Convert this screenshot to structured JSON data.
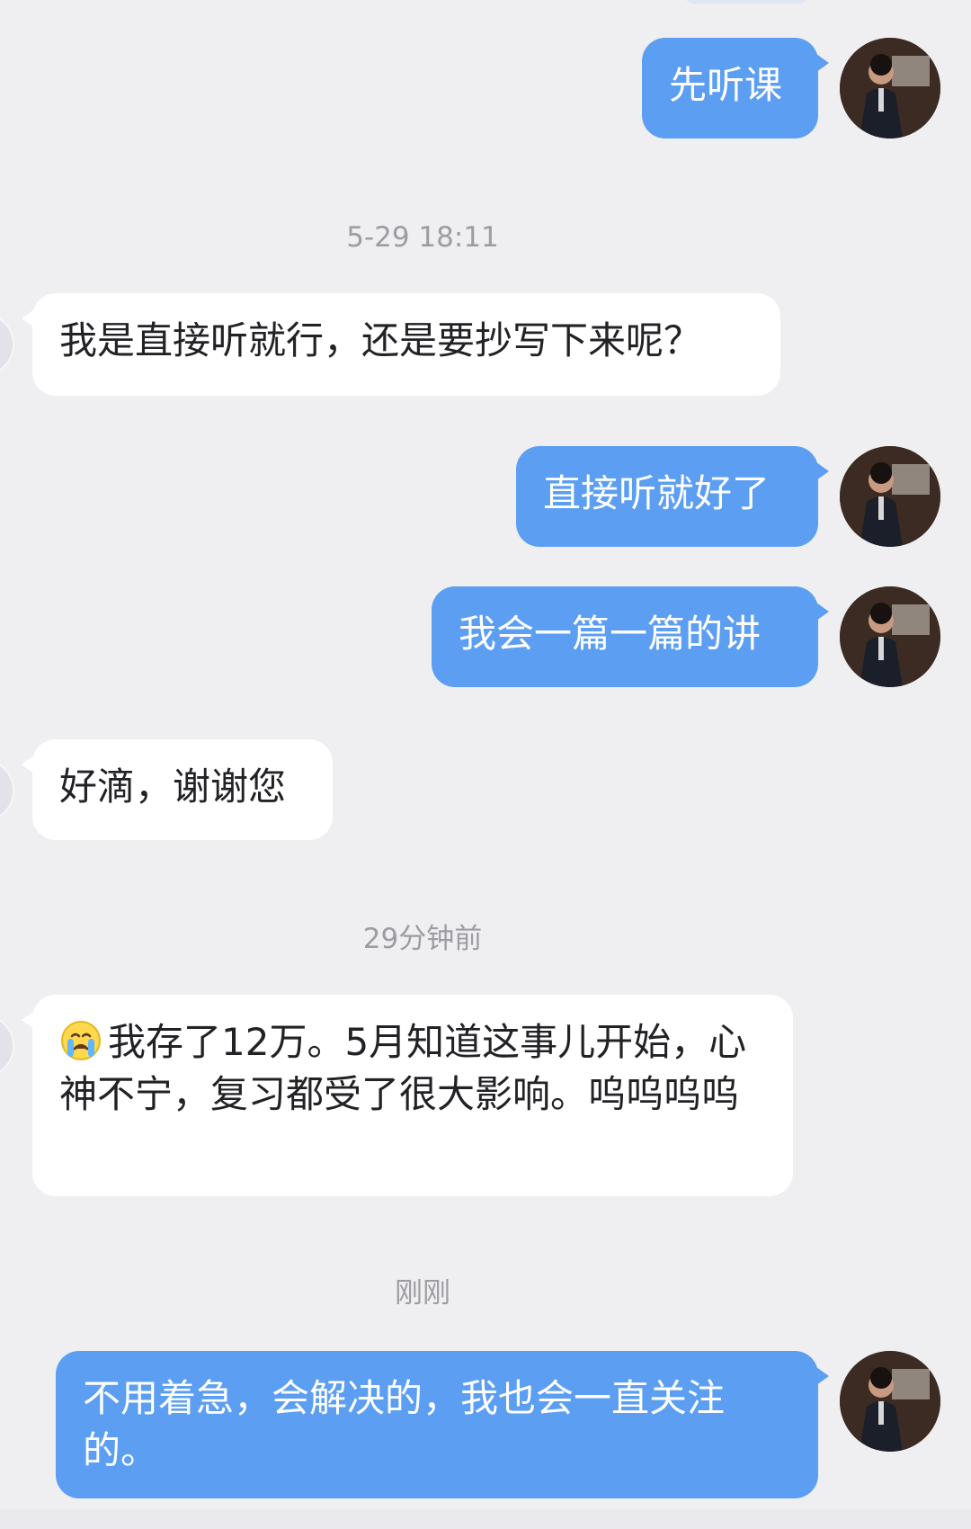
{
  "conversation": {
    "messages": [
      {
        "type": "outgoing",
        "text": "先听课"
      },
      {
        "type": "timestamp",
        "text": "5-29 18:11"
      },
      {
        "type": "incoming",
        "text": "我是直接听就行，还是要抄写下来呢？"
      },
      {
        "type": "outgoing",
        "text": "直接听就好了"
      },
      {
        "type": "outgoing",
        "text": "我会一篇一篇的讲"
      },
      {
        "type": "incoming",
        "text": "好滴，谢谢您"
      },
      {
        "type": "timestamp",
        "text": "29分钟前"
      },
      {
        "type": "incoming",
        "emoji": "crying-face",
        "text": "我存了12万。5月知道这事儿开始，心神不宁，复习都受了很大影响。呜呜呜呜"
      },
      {
        "type": "timestamp",
        "text": "刚刚"
      },
      {
        "type": "outgoing",
        "text": "不用着急，会解决的，我也会一直关注的。"
      }
    ]
  },
  "colors": {
    "background": "#efeff1",
    "outgoing_bubble": "#5b9ef2",
    "incoming_bubble": "#ffffff",
    "timestamp_text": "#9c9ca3"
  }
}
